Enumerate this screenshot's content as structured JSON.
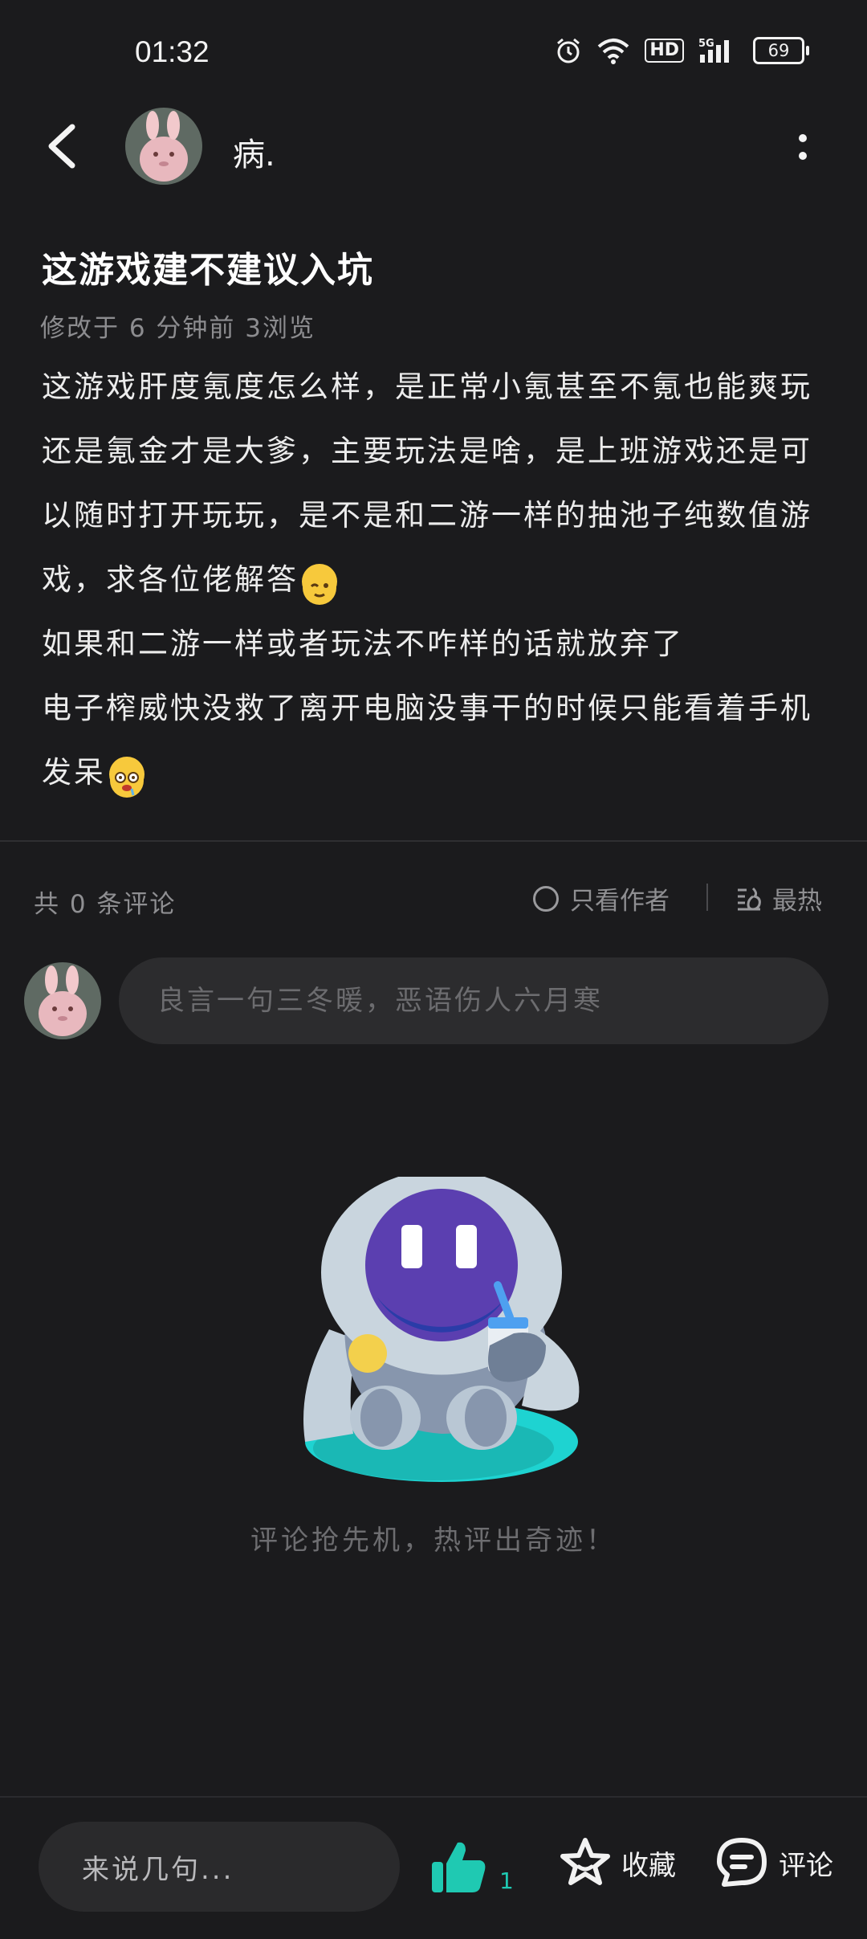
{
  "status_bar": {
    "time": "01:32",
    "battery": "69",
    "network": "5G",
    "hd": "HD",
    "icons": [
      "alarm-icon",
      "wifi-icon",
      "hd-icon",
      "signal-5g-icon",
      "battery-icon"
    ]
  },
  "header": {
    "author_name": "病.",
    "back_icon": "back-arrow-icon",
    "more_icon": "more-vertical-icon"
  },
  "post": {
    "title": "这游戏建不建议入坑",
    "meta": "修改于 6 分钟前  3浏览",
    "paragraphs": [
      "这游戏肝度氪度怎么样，是正常小氪甚至不氪也能爽玩还是氪金才是大爹，主要玩法是啥，是上班游戏还是可以随时打开玩玩，是不是和二游一样的抽池子纯数值游戏，求各位佬解答",
      "如果和二游一样或者玩法不咋样的话就放弃了",
      "电子榨威快没救了离开电脑没事干的时候只能看着手机发呆"
    ]
  },
  "comments": {
    "count_label": "共 0 条评论",
    "filter_author_label": "只看作者",
    "sort_label": "最热",
    "input_placeholder": "良言一句三冬暖，恶语伤人六月寒",
    "empty_text": "评论抢先机，热评出奇迹！"
  },
  "bottom_bar": {
    "say_placeholder": "来说几句...",
    "like_count": "1",
    "favorite_label": "收藏",
    "comment_label": "评论",
    "accent_color": "#1fc9b2"
  }
}
